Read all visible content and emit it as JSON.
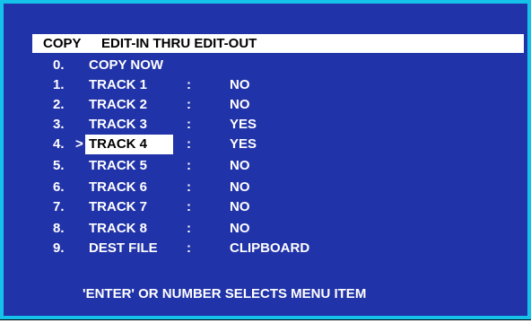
{
  "window": {
    "colors": {
      "background": "#2133a8",
      "border": "#14c2ea",
      "text": "#ffffff",
      "highlight": "#ffffff"
    }
  },
  "header": {
    "title_part1": "COPY",
    "title_part2": "EDIT-IN THRU EDIT-OUT"
  },
  "menu": {
    "cursor_symbol": ">",
    "selected_index": 4,
    "items": [
      {
        "number": "0.",
        "label": "COPY NOW",
        "colon": "",
        "value": ""
      },
      {
        "number": "1.",
        "label": "TRACK 1",
        "colon": ":",
        "value": "NO"
      },
      {
        "number": "2.",
        "label": "TRACK 2",
        "colon": ":",
        "value": "NO"
      },
      {
        "number": "3.",
        "label": "TRACK 3",
        "colon": ":",
        "value": "YES"
      },
      {
        "number": "4.",
        "label": "TRACK 4",
        "colon": ":",
        "value": "YES"
      },
      {
        "number": "5.",
        "label": "TRACK 5",
        "colon": ":",
        "value": "NO"
      },
      {
        "number": "6.",
        "label": "TRACK 6",
        "colon": ":",
        "value": "NO"
      },
      {
        "number": "7.",
        "label": "TRACK 7",
        "colon": ":",
        "value": "NO"
      },
      {
        "number": "8.",
        "label": "TRACK 8",
        "colon": ":",
        "value": "NO"
      },
      {
        "number": "9.",
        "label": "DEST FILE",
        "colon": ":",
        "value": "CLIPBOARD"
      }
    ]
  },
  "footer": {
    "hint": "'ENTER' OR NUMBER SELECTS MENU ITEM"
  }
}
